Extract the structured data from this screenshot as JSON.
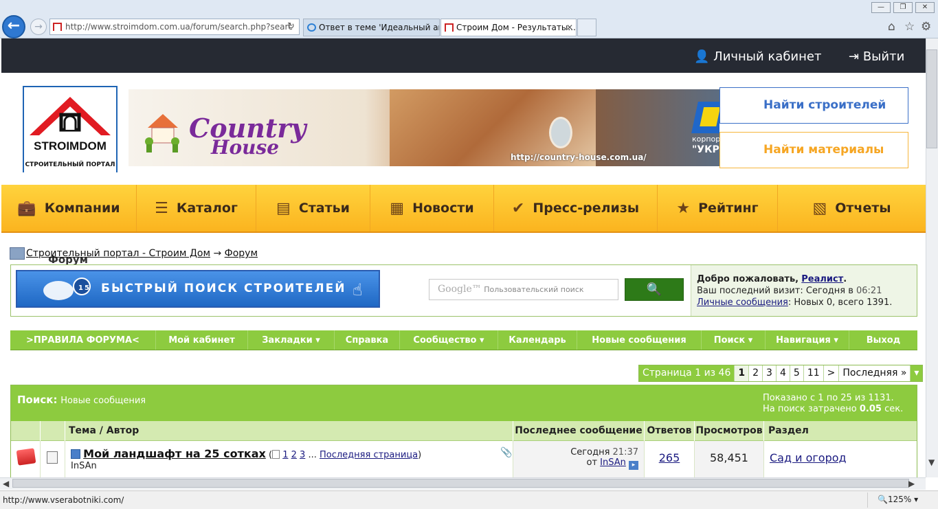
{
  "browser": {
    "url": "http://www.stroimdom.com.ua/forum/search.php?searc",
    "tabs": [
      {
        "label": "Ответ в теме 'Идеальный авт..."
      },
      {
        "label": "Строим Дом - Результаты..."
      }
    ],
    "status_url": "http://www.vserabotniki.com/",
    "zoom": "125%"
  },
  "site": {
    "cabinet": "Личный кабинет",
    "logout": "Выйти",
    "logo_text": "STROIMDOM",
    "logo_sub": "СТРОИТЕЛЬНЫЙ ПОРТАЛ",
    "banner": {
      "title1": "Country",
      "title2": "House",
      "url": "http://country-house.com.ua/",
      "corp1": "корпорация",
      "corp2": "\"УКРБУД\""
    },
    "find_builders": "Найти строителей",
    "find_materials": "Найти материалы",
    "nav": [
      {
        "label": "Компании",
        "icon": "briefcase-icon",
        "glyph": "💼"
      },
      {
        "label": "Каталог",
        "icon": "list-icon",
        "glyph": "☰"
      },
      {
        "label": "Статьи",
        "icon": "document-icon",
        "glyph": "▤"
      },
      {
        "label": "Новости",
        "icon": "newspaper-icon",
        "glyph": "▦"
      },
      {
        "label": "Пресс-релизы",
        "icon": "check-circle-icon",
        "glyph": "✔"
      },
      {
        "label": "Рейтинг",
        "icon": "star-icon",
        "glyph": "★"
      },
      {
        "label": "Отчеты",
        "icon": "report-icon",
        "glyph": "▧"
      }
    ]
  },
  "forum": {
    "breadcrumb": {
      "portal": "Строительный портал - Строим Дом",
      "arrow": "→",
      "forum": "Форум"
    },
    "title": "Форум",
    "promo": "БЫСТРЫЙ ПОИСК СТРОИТЕЛЕЙ",
    "google_placeholder": "Пользовательский поиск",
    "google_brand": "Google™",
    "welcome": {
      "greeting": "Добро пожаловать,",
      "user": "Реалист",
      "last_visit": "Ваш последний визит: Сегодня в",
      "last_time": "06:21",
      "pm_link": "Личные сообщения",
      "pm_text": ": Новых 0, всего 1391."
    },
    "menu": [
      {
        "label": ">ПРАВИЛА ФОРУМА<",
        "dropdown": false
      },
      {
        "label": "Мой кабинет",
        "dropdown": false
      },
      {
        "label": "Закладки",
        "dropdown": true
      },
      {
        "label": "Справка",
        "dropdown": false
      },
      {
        "label": "Сообщество",
        "dropdown": true
      },
      {
        "label": "Календарь",
        "dropdown": false
      },
      {
        "label": "Новые сообщения",
        "dropdown": false
      },
      {
        "label": "Поиск",
        "dropdown": true
      },
      {
        "label": "Навигация",
        "dropdown": true
      },
      {
        "label": "Выход",
        "dropdown": false
      }
    ],
    "pager": {
      "summary": "Страница 1 из 46",
      "pages": [
        "1",
        "2",
        "3",
        "4",
        "5",
        "11"
      ],
      "next": ">",
      "last": "Последняя »"
    },
    "results": {
      "title": "Поиск:",
      "subtitle": "Новые сообщения",
      "shown": "Показано с 1 по 25 из 1131.",
      "time_label": "На поиск затрачено",
      "time_value": "0.05",
      "time_unit": "сек.",
      "columns": [
        "Тема / Автор",
        "Последнее сообщение",
        "Ответов",
        "Просмотров",
        "Раздел"
      ],
      "rows": [
        {
          "topic": "Мой ландшафт на 25 сотках",
          "pages": [
            "1",
            "2",
            "3"
          ],
          "ellipsis": "...",
          "last_page": "Последняя страница",
          "author": "InSAn",
          "last_date": "Сегодня",
          "last_time": "21:37",
          "last_from": "от",
          "last_user": "InSAn",
          "replies": "265",
          "views": "58,451",
          "section": "Сад и огород"
        }
      ]
    }
  },
  "colors": {
    "green": "#8dcb3f",
    "orange": "#fbb41f",
    "dark": "#262a33",
    "blue": "#3a6fc7"
  }
}
